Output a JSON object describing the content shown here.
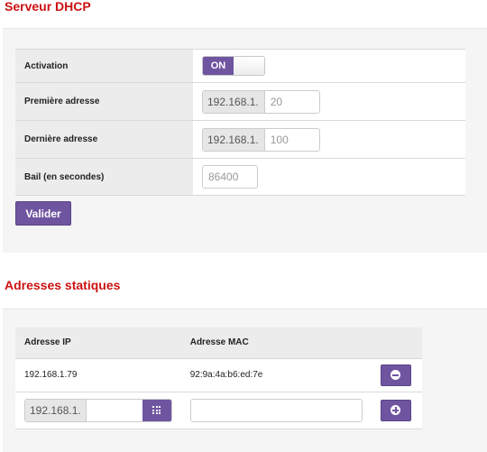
{
  "dhcp": {
    "title": "Serveur DHCP",
    "activation_label": "Activation",
    "activation_value": "ON",
    "first_label": "Première adresse",
    "first_prefix": "192.168.1.",
    "first_value": "20",
    "last_label": "Dernière adresse",
    "last_prefix": "192.168.1.",
    "last_value": "100",
    "lease_label": "Bail (en secondes)",
    "lease_value": "86400",
    "submit_label": "Valider"
  },
  "static": {
    "title": "Adresses statiques",
    "col_ip": "Adresse IP",
    "col_mac": "Adresse MAC",
    "entries": [
      {
        "ip": "192.168.1.79",
        "mac": "92:9a:4a:b6:ed:7e"
      }
    ],
    "new_prefix": "192.168.1.",
    "new_ip_value": "",
    "new_mac_value": ""
  },
  "colors": {
    "accent": "#6f55a0",
    "title": "#cc1111"
  },
  "icons": [
    "minus-circle-icon",
    "plus-circle-icon",
    "grid-icon"
  ]
}
